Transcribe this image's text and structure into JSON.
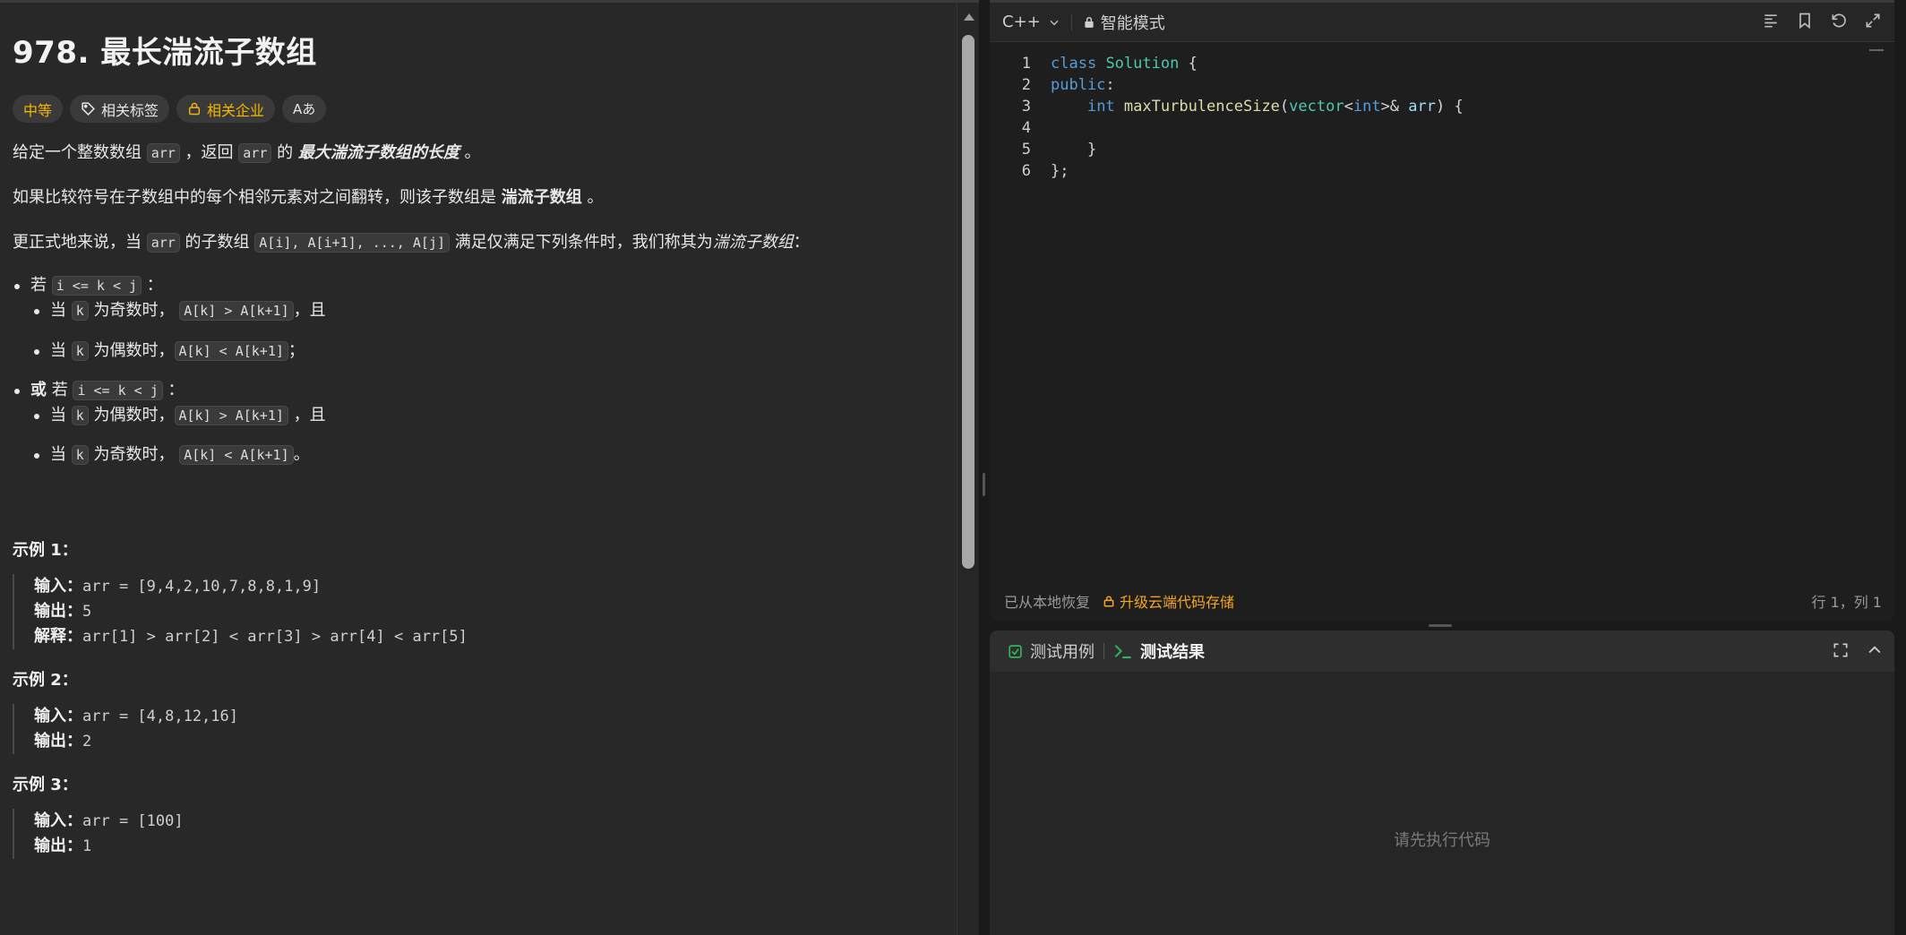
{
  "problem": {
    "title": "978. 最长湍流子数组",
    "tags": {
      "difficulty": "中等",
      "related_tags": "相关标签",
      "related_companies": "相关企业",
      "translate": "Aあ"
    },
    "desc": {
      "p1_a": "给定一个整数数组 ",
      "p1_code1": "arr",
      "p1_b": " ，返回 ",
      "p1_code2": "arr",
      "p1_c": " 的 ",
      "p1_em": "最大湍流子数组的长度",
      "p1_d": " 。",
      "p2_a": "如果比较符号在子数组中的每个相邻元素对之间翻转，则该子数组是 ",
      "p2_b": "湍流子数组",
      "p2_c": " 。",
      "p3_a": "更正式地来说，当 ",
      "p3_code1": "arr",
      "p3_b": " 的子数组 ",
      "p3_code2": "A[i], A[i+1], ..., A[j]",
      "p3_c": " 满足仅满足下列条件时，我们称其为",
      "p3_em": "湍流子数组",
      "p3_d": "："
    },
    "cond1": {
      "a": "若 ",
      "code": "i <= k < j",
      "b": " ：",
      "s1_a": "当 ",
      "s1_code1": "k",
      "s1_b": " 为奇数时， ",
      "s1_code2": "A[k] > A[k+1]",
      "s1_c": "，且",
      "s2_a": "当 ",
      "s2_code1": "k",
      "s2_b": " 为偶数时，",
      "s2_code2": "A[k] < A[k+1]",
      "s2_c": "；"
    },
    "cond2": {
      "a1": "或",
      "a2": " 若 ",
      "code": "i <= k < j",
      "b": " ：",
      "s1_a": "当 ",
      "s1_code1": "k",
      "s1_b": " 为偶数时，",
      "s1_code2": "A[k] > A[k+1]",
      "s1_c": " ，且",
      "s2_a": "当 ",
      "s2_code1": "k",
      "s2_b": " 为奇数时， ",
      "s2_code2": "A[k] < A[k+1]",
      "s2_c": "。"
    },
    "examples": [
      {
        "title": "示例 1：",
        "lines": [
          {
            "k": "输入：",
            "v": "arr = [9,4,2,10,7,8,8,1,9]"
          },
          {
            "k": "输出：",
            "v": "5"
          },
          {
            "k": "解释：",
            "v": "arr[1] > arr[2] < arr[3] > arr[4] < arr[5]"
          }
        ]
      },
      {
        "title": "示例 2：",
        "lines": [
          {
            "k": "输入：",
            "v": "arr = [4,8,12,16]"
          },
          {
            "k": "输出：",
            "v": "2"
          }
        ]
      },
      {
        "title": "示例 3：",
        "lines": [
          {
            "k": "输入：",
            "v": "arr = [100]"
          },
          {
            "k": "输出：",
            "v": "1"
          }
        ]
      }
    ]
  },
  "editor": {
    "language": "C++",
    "mode": "智能模式",
    "line_numbers": [
      "1",
      "2",
      "3",
      "4",
      "5",
      "6"
    ],
    "code": {
      "l1_kw": "class",
      "l1_ty": "Solution",
      "l1_rest": " {",
      "l2_kw": "public",
      "l2_rest": ":",
      "l3_ind": "    ",
      "l3_kw": "int",
      "l3_fn": "maxTurbulenceSize",
      "l3_p1": "(",
      "l3_ty": "vector",
      "l3_p2": "<",
      "l3_kw2": "int",
      "l3_p3": ">& ",
      "l3_pm": "arr",
      "l3_p4": ") {",
      "l4": "",
      "l5": "    }",
      "l6": "};"
    },
    "status": {
      "restored": "已从本地恢复",
      "upgrade": "升级云端代码存储",
      "position": "行 1，列 1"
    }
  },
  "test_panel": {
    "tab_cases": "测试用例",
    "tab_results": "测试结果",
    "empty_message": "请先执行代码"
  },
  "colors": {
    "accent_orange": "#f5a623",
    "difficulty_yellow": "#f5b800",
    "test_green": "#2db55d"
  }
}
